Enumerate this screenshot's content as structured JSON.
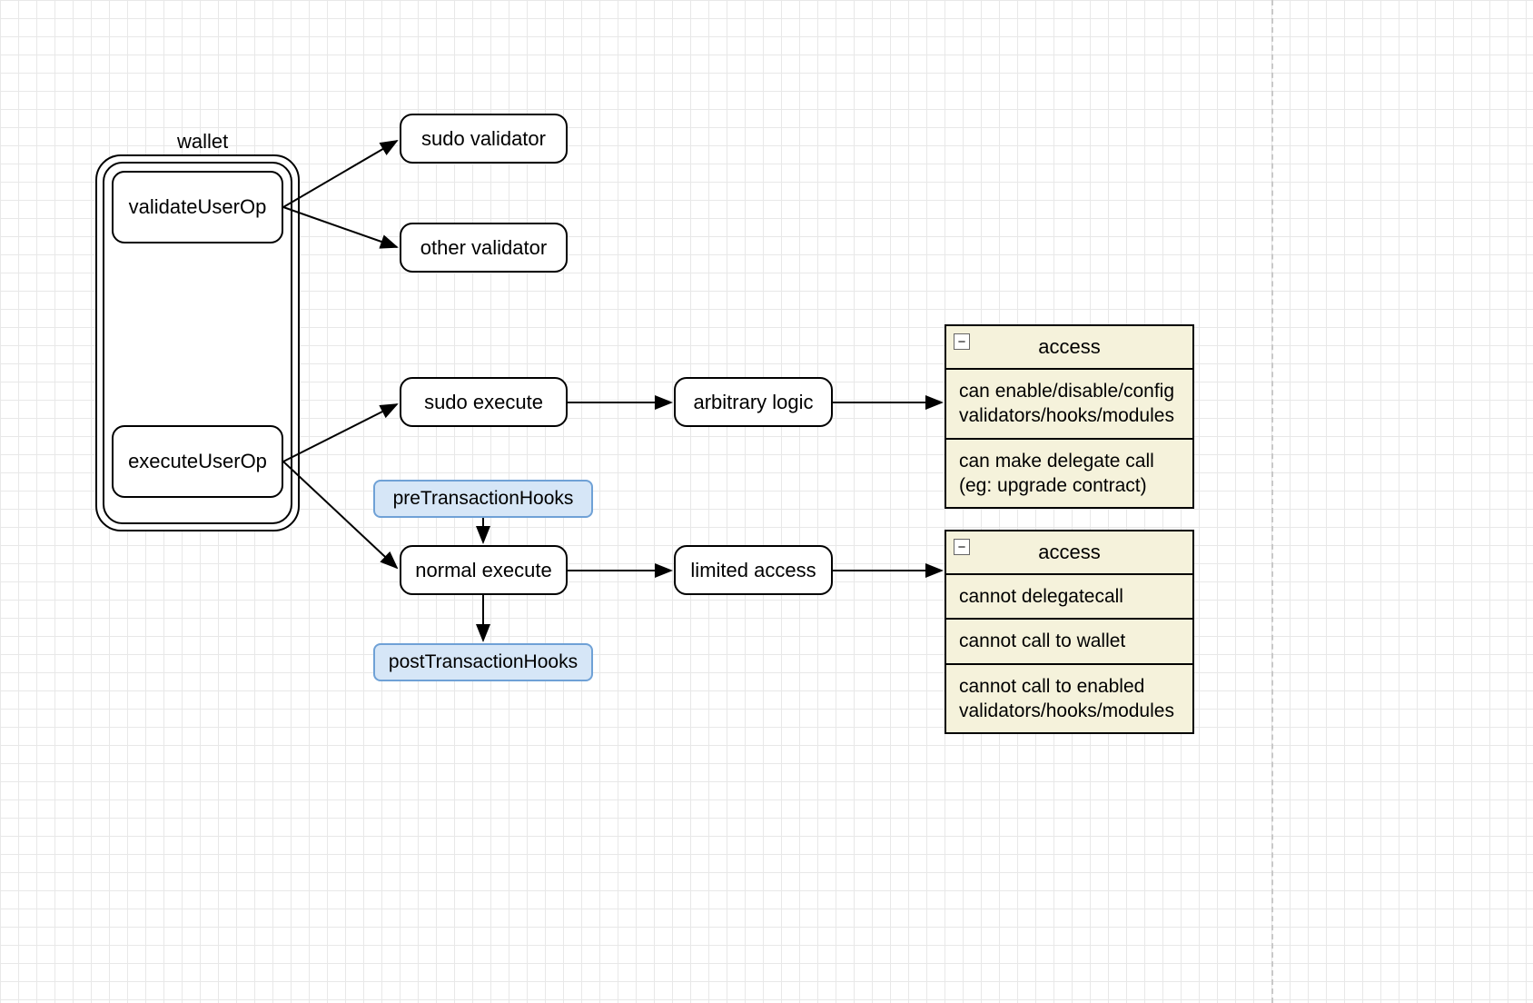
{
  "wallet": {
    "title": "wallet",
    "validate": "validateUserOp",
    "execute": "executeUserOp"
  },
  "validators": {
    "sudo": "sudo validator",
    "other": "other validator"
  },
  "executes": {
    "sudo": "sudo execute",
    "normal": "normal execute"
  },
  "hooks": {
    "pre": "preTransactionHooks",
    "post": "postTransactionHooks"
  },
  "midboxes": {
    "arbitrary": "arbitrary logic",
    "limited": "limited access"
  },
  "access_sudo": {
    "title": "access",
    "rows": [
      "can enable/disable/config validators/hooks/modules",
      "can make delegate call (eg: upgrade contract)"
    ]
  },
  "access_normal": {
    "title": "access",
    "rows": [
      "cannot delegatecall",
      "cannot call to wallet",
      "cannot call to enabled validators/hooks/modules"
    ]
  },
  "icons": {
    "collapse": "−"
  }
}
